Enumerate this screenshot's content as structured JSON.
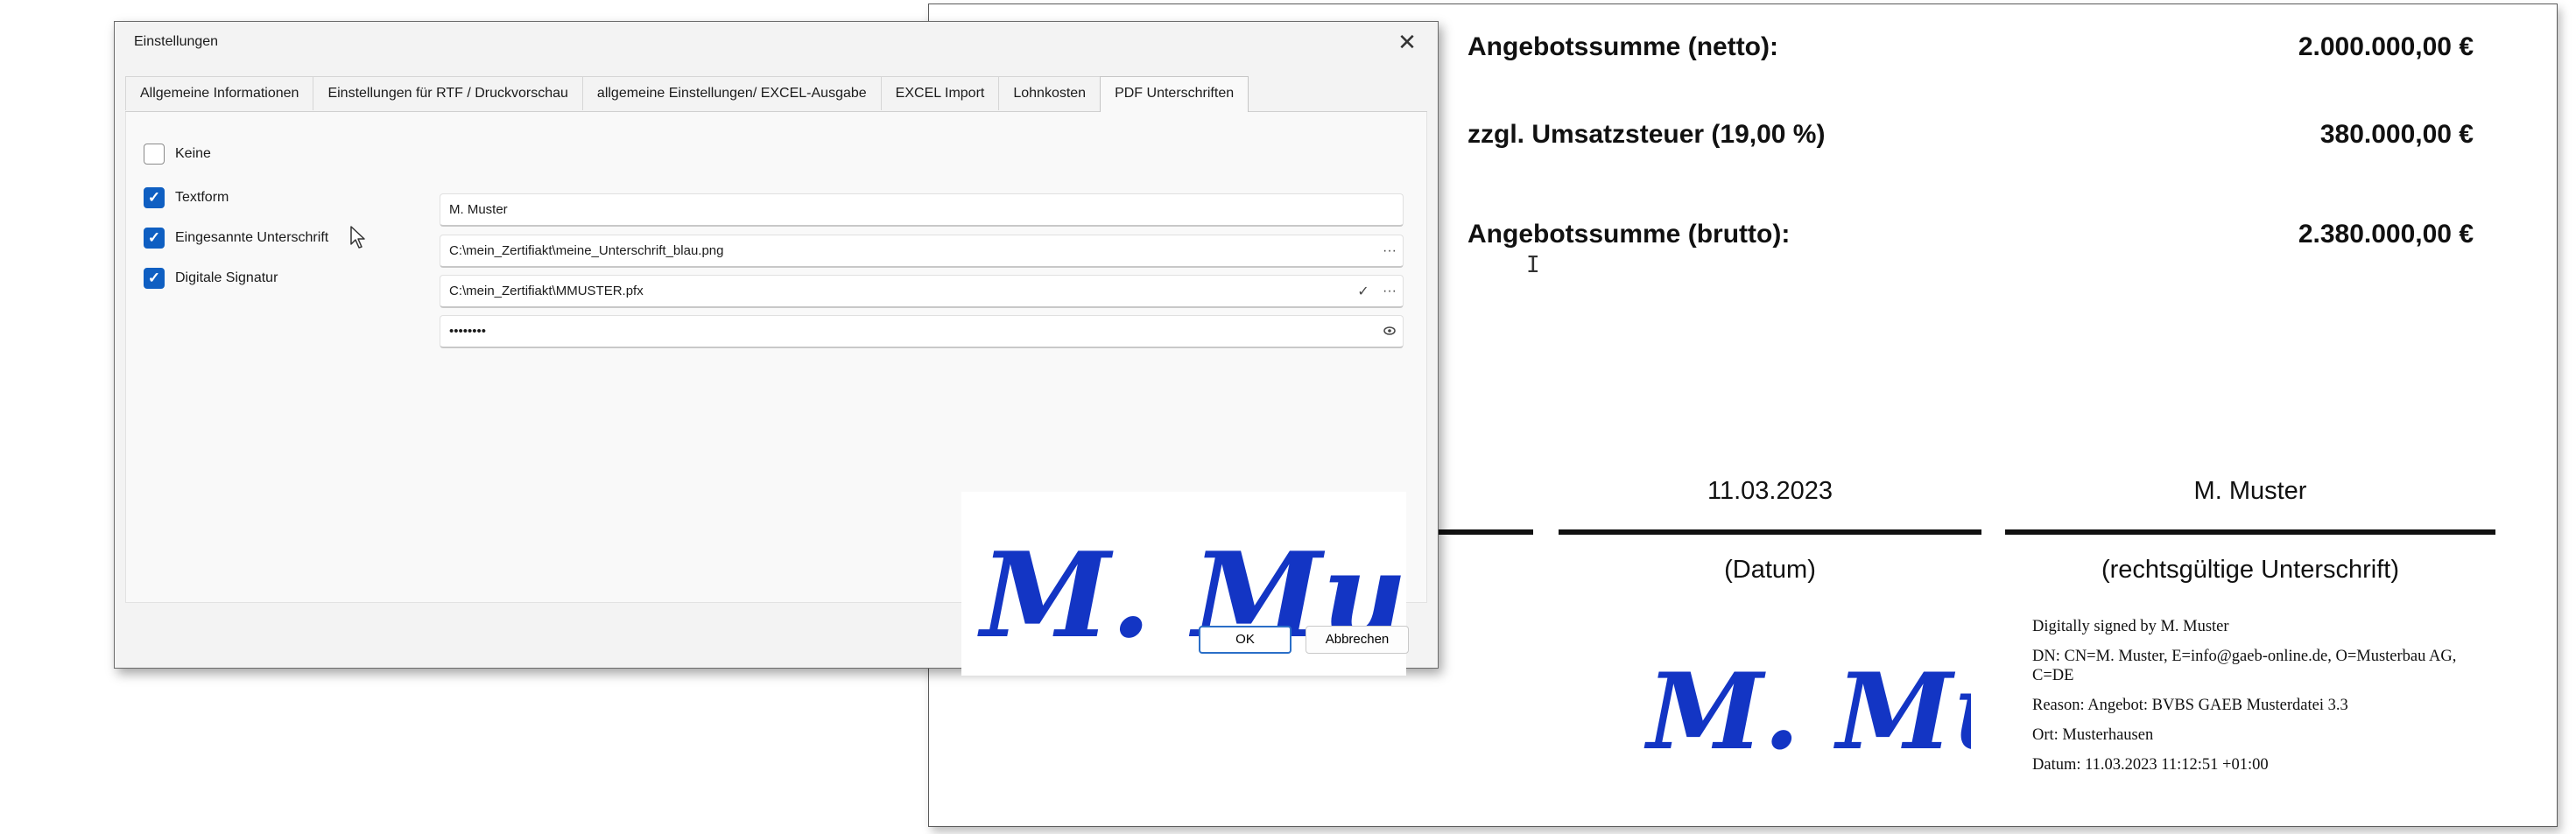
{
  "pdf": {
    "net_label": "Angebotssumme (netto):",
    "net_amount": "2.000.000,00 €",
    "vat_label": "zzgl. Umsatzsteuer (19,00 %)",
    "vat_amount": "380.000,00 €",
    "gross_label": "Angebotssumme (brutto):",
    "gross_amount": "2.380.000,00 €",
    "date_value": "11.03.2023",
    "date_caption": "(Datum)",
    "signer_value": "M. Muster",
    "signer_caption": "(rechtsgültige Unterschrift)",
    "handwritten_signature": "M. Muster",
    "certificate": {
      "signed_by": "Digitally signed by M. Muster",
      "dn": "DN: CN=M. Muster, E=info@gaeb-online.de, O=Musterbau AG, C=DE",
      "reason": "Reason: Angebot: BVBS GAEB Musterdatei 3.3",
      "location": "Ort: Musterhausen",
      "date": "Datum: 11.03.2023 11:12:51 +01:00"
    }
  },
  "dialog": {
    "title": "Einstellungen",
    "tabs": [
      {
        "label": "Allgemeine Informationen",
        "active": false
      },
      {
        "label": "Einstellungen für RTF / Druckvorschau",
        "active": false
      },
      {
        "label": "allgemeine Einstellungen/ EXCEL-Ausgabe",
        "active": false
      },
      {
        "label": "EXCEL Import",
        "active": false
      },
      {
        "label": "Lohnkosten",
        "active": false
      },
      {
        "label": "PDF Unterschriften",
        "active": true
      }
    ],
    "options": {
      "none": {
        "label": "Keine",
        "checked": false
      },
      "text_form": {
        "label": "Textform",
        "checked": true
      },
      "scanned_signature": {
        "label": "Eingesannte Unterschrift",
        "checked": true
      },
      "digital_signature": {
        "label": "Digitale Signatur",
        "checked": true
      }
    },
    "fields": {
      "name": "M. Muster",
      "image_path": "C:\\mein_Zertifiakt\\meine_Unterschrift_blau.png",
      "certificate_path": "C:\\mein_Zertifiakt\\MMUSTER.pfx",
      "password": "••••••••"
    },
    "icons": {
      "close": "close-icon",
      "browse": "ellipsis-icon",
      "valid": "checkmark-icon",
      "reveal": "eye-icon"
    },
    "preview_signature": "M. Muster",
    "ok_label": "OK",
    "cancel_label": "Abbrechen"
  },
  "colors": {
    "accent": "#0f5fc2",
    "signature_ink": "#1335c4"
  }
}
